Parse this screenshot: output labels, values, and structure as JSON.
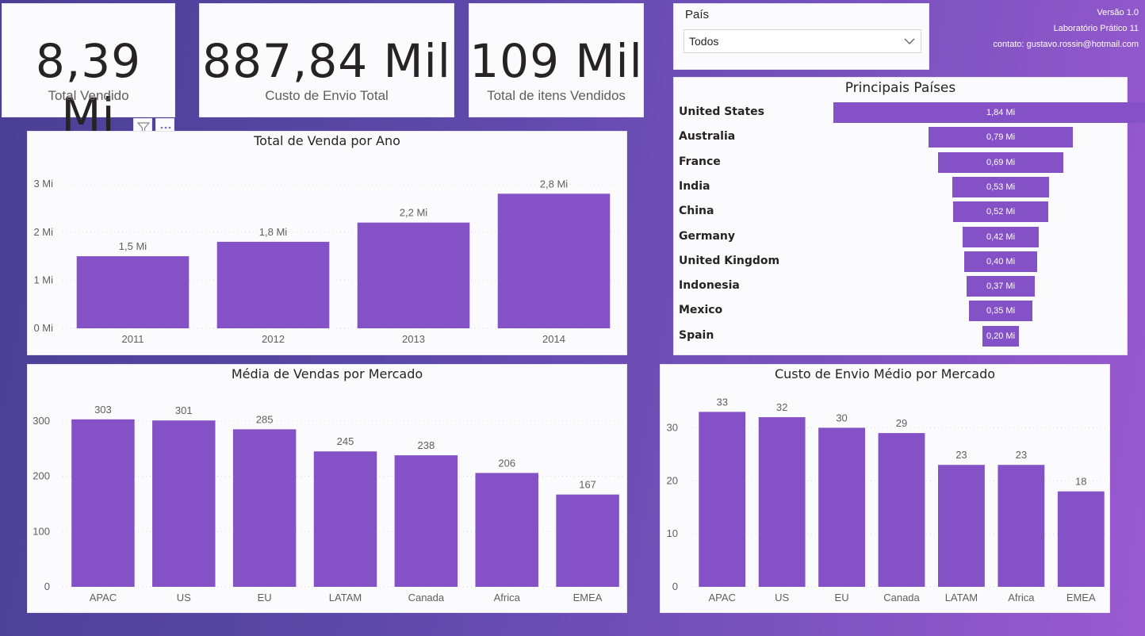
{
  "kpis": [
    {
      "value": "8,39 Mi",
      "label": "Total Vendido"
    },
    {
      "value": "887,84 Mil",
      "label": "Custo de Envio Total"
    },
    {
      "value": "109 Mil",
      "label": "Total de itens Vendidos"
    }
  ],
  "slicer": {
    "title": "País",
    "value": "Todos"
  },
  "info": {
    "version": "Versão 1.0",
    "lab": "Laboratório Prático 11",
    "contact": "contato: gustavo.rossin@hotmail.com"
  },
  "accent_color": "#8451c6",
  "funnel": {
    "title": "Principais Países",
    "items": [
      {
        "country": "United States",
        "value": 1.84,
        "label": "1,84 Mi"
      },
      {
        "country": "Australia",
        "value": 0.79,
        "label": "0,79 Mi"
      },
      {
        "country": "France",
        "value": 0.69,
        "label": "0,69 Mi"
      },
      {
        "country": "India",
        "value": 0.53,
        "label": "0,53 Mi"
      },
      {
        "country": "China",
        "value": 0.52,
        "label": "0,52 Mi"
      },
      {
        "country": "Germany",
        "value": 0.42,
        "label": "0,42 Mi"
      },
      {
        "country": "United Kingdom",
        "value": 0.4,
        "label": "0,40 Mi"
      },
      {
        "country": "Indonesia",
        "value": 0.37,
        "label": "0,37 Mi"
      },
      {
        "country": "Mexico",
        "value": 0.35,
        "label": "0,35 Mi"
      },
      {
        "country": "Spain",
        "value": 0.2,
        "label": "0,20 Mi"
      }
    ]
  },
  "chart_data": [
    {
      "type": "bar",
      "title": "Total de Venda por Ano",
      "categories": [
        "2011",
        "2012",
        "2013",
        "2014"
      ],
      "values": [
        1.5,
        1.8,
        2.2,
        2.8
      ],
      "value_labels": [
        "1,5 Mi",
        "1,8 Mi",
        "2,2 Mi",
        "2,8 Mi"
      ],
      "yticks": [
        0,
        1,
        2,
        3
      ],
      "ytick_labels": [
        "0 Mi",
        "1 Mi",
        "2 Mi",
        "3 Mi"
      ],
      "ylim": [
        0,
        3.3
      ],
      "grid": true
    },
    {
      "type": "bar",
      "title": "Média de Vendas por Mercado",
      "categories": [
        "APAC",
        "US",
        "EU",
        "LATAM",
        "Canada",
        "Africa",
        "EMEA"
      ],
      "values": [
        303,
        301,
        285,
        245,
        238,
        206,
        167
      ],
      "value_labels": [
        "303",
        "301",
        "285",
        "245",
        "238",
        "206",
        "167"
      ],
      "yticks": [
        0,
        100,
        200,
        300
      ],
      "ytick_labels": [
        "0",
        "100",
        "200",
        "300"
      ],
      "ylim": [
        0,
        330
      ],
      "grid": true
    },
    {
      "type": "bar",
      "title": "Custo de Envio Médio por Mercado",
      "categories": [
        "APAC",
        "US",
        "EU",
        "Canada",
        "LATAM",
        "Africa",
        "EMEA"
      ],
      "values": [
        33,
        32,
        30,
        29,
        23,
        23,
        18
      ],
      "value_labels": [
        "33",
        "32",
        "30",
        "29",
        "23",
        "23",
        "18"
      ],
      "yticks": [
        0,
        10,
        20,
        30
      ],
      "ytick_labels": [
        "0",
        "10",
        "20",
        "30"
      ],
      "ylim": [
        0,
        35
      ],
      "grid": true
    }
  ]
}
